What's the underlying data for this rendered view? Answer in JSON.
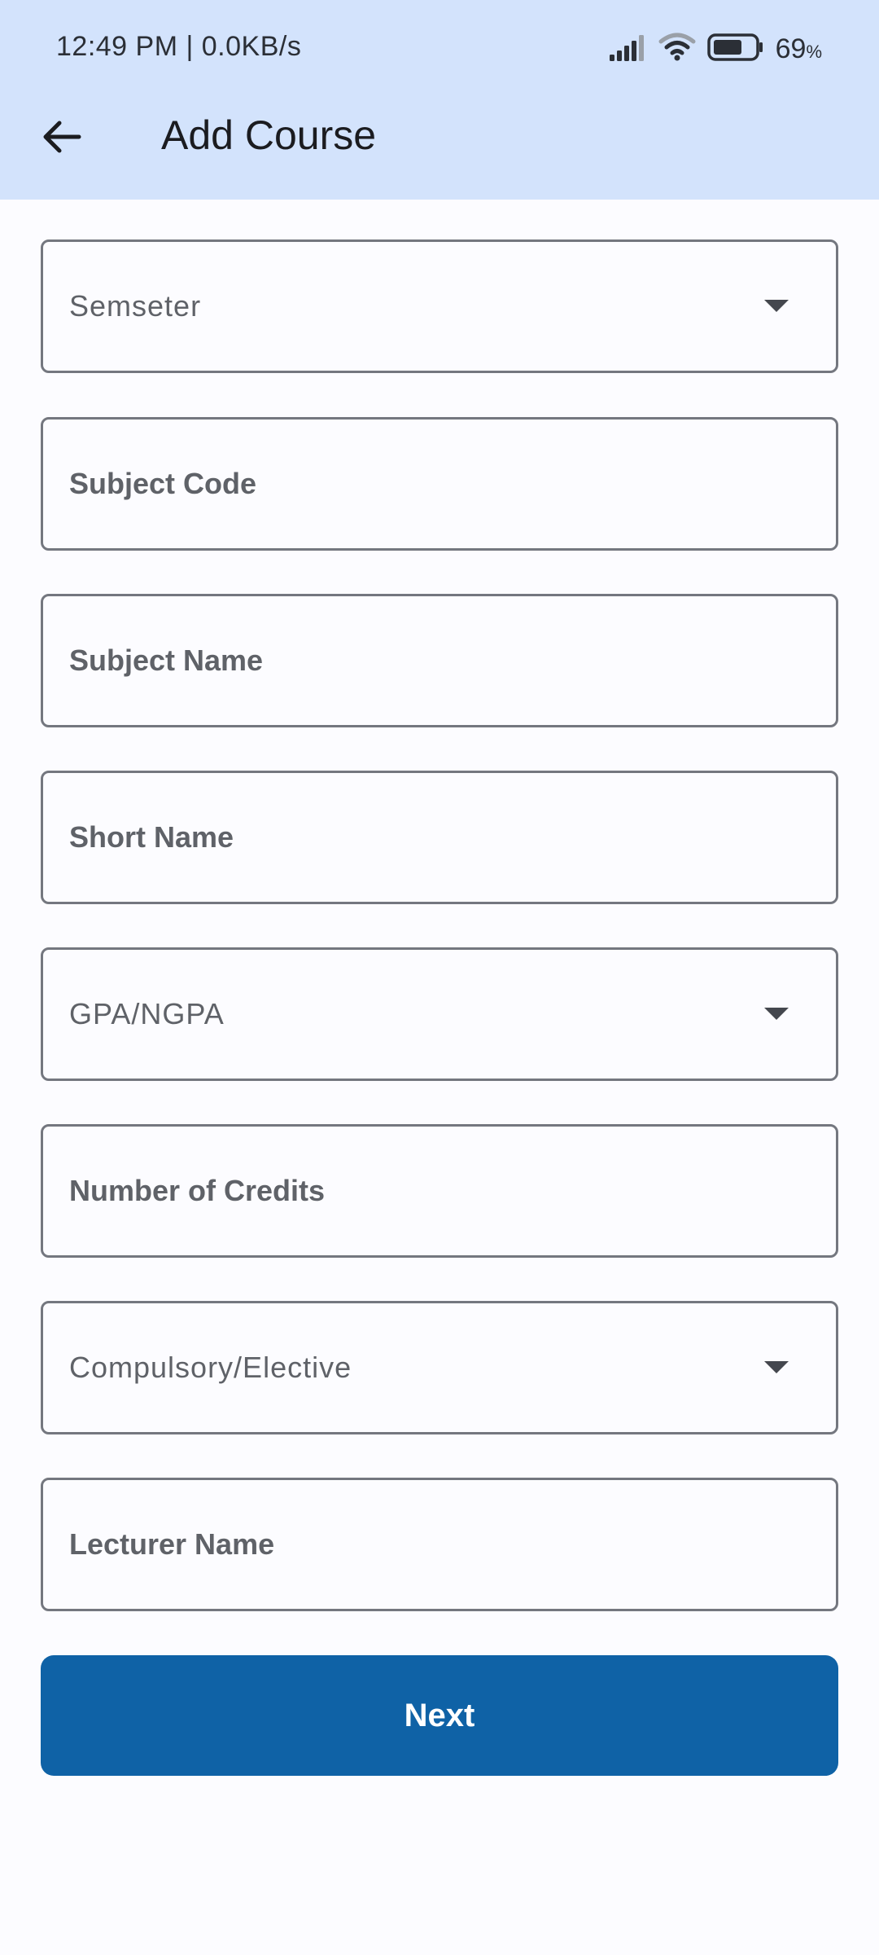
{
  "status_bar": {
    "time": "12:49 PM | 0.0KB/s",
    "battery_value": "69",
    "battery_unit": "%"
  },
  "header": {
    "title": "Add Course",
    "back_icon": "arrow-left-icon"
  },
  "form": {
    "semester": {
      "label": "Semseter",
      "icon": "dropdown-arrow-icon"
    },
    "subject_code": {
      "placeholder": "Subject Code"
    },
    "subject_name": {
      "placeholder": "Subject Name"
    },
    "short_name": {
      "placeholder": "Short Name"
    },
    "gpa_type": {
      "label": "GPA/NGPA",
      "icon": "dropdown-arrow-icon"
    },
    "credits": {
      "placeholder": "Number of Credits"
    },
    "course_type": {
      "label": "Compulsory/Elective",
      "icon": "dropdown-arrow-icon"
    },
    "lecturer": {
      "placeholder": "Lecturer Name"
    }
  },
  "actions": {
    "next_label": "Next"
  },
  "colors": {
    "appbar": "#d3e3fc",
    "background": "#fcfcff",
    "primary_button": "#0f62a6",
    "field_border": "#74777f"
  }
}
